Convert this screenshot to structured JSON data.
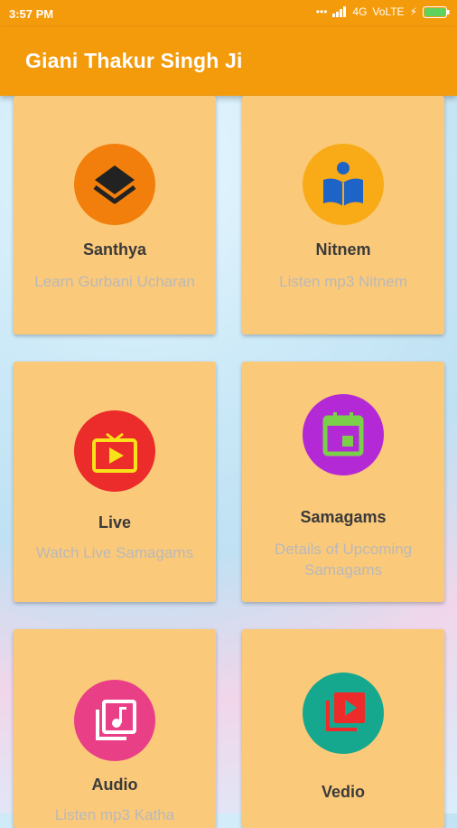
{
  "status_bar": {
    "time": "3:57 PM",
    "signal_text": "4G",
    "carrier": "VoLTE"
  },
  "app_bar": {
    "title": "Giani Thakur Singh Ji"
  },
  "cards": [
    {
      "title": "Santhya",
      "subtitle": "Learn Gurbani Ucharan",
      "icon": "layers-icon",
      "color": "#f27f0b"
    },
    {
      "title": "Nitnem",
      "subtitle": "Listen mp3 Nitnem",
      "icon": "reader-book-icon",
      "color": "#f8ab17"
    },
    {
      "title": "Live",
      "subtitle": "Watch Live Samagams",
      "icon": "live-tv-icon",
      "color": "#ec2b2b"
    },
    {
      "title": "Samagams",
      "subtitle": "Details of Upcoming Samagams",
      "icon": "calendar-icon",
      "color": "#b429d6"
    },
    {
      "title": "Audio",
      "subtitle": "Listen mp3 Katha",
      "icon": "music-library-icon",
      "color": "#e93f86"
    },
    {
      "title": "Vedio",
      "subtitle": "",
      "icon": "video-library-icon",
      "color": "#16a88e"
    }
  ],
  "colors": {
    "app_bar": "#f49b0c",
    "card": "#fbc97a"
  }
}
